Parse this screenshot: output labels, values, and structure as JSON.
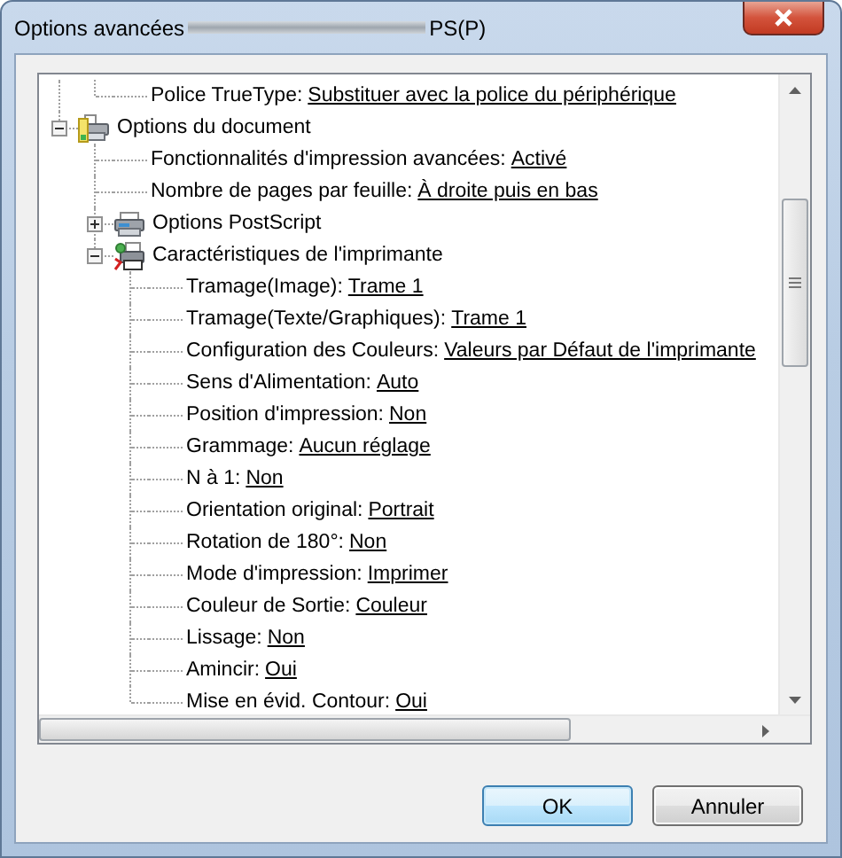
{
  "window": {
    "title": "Options avancées",
    "title_suffix": "PS(P)"
  },
  "tree": {
    "items": [
      {
        "children": [
          {
            "label": "Police TrueType:",
            "value": "Substituer avec la police du périphérique"
          }
        ]
      },
      {
        "label": "Options du document",
        "kind": "document",
        "expanded": true,
        "children": [
          {
            "label": "Fonctionnalités d'impression avancées:",
            "value": "Activé"
          },
          {
            "label": "Nombre de pages par feuille:",
            "value": "À droite puis en bas"
          },
          {
            "label": "Options PostScript",
            "kind": "postscript",
            "expanded": false
          },
          {
            "label": "Caractéristiques de l'imprimante",
            "kind": "device",
            "expanded": true,
            "children": [
              {
                "label": "Tramage(Image):",
                "value": "Trame 1"
              },
              {
                "label": "Tramage(Texte/Graphiques):",
                "value": "Trame 1"
              },
              {
                "label": "Configuration des Couleurs:",
                "value": "Valeurs par Défaut de l'imprimante"
              },
              {
                "label": "Sens d'Alimentation:",
                "value": "Auto"
              },
              {
                "label": "Position d'impression:",
                "value": "Non"
              },
              {
                "label": "Grammage:",
                "value": "Aucun réglage"
              },
              {
                "label": "N à 1:",
                "value": "Non"
              },
              {
                "label": "Orientation original:",
                "value": "Portrait"
              },
              {
                "label": "Rotation de 180°:",
                "value": "Non"
              },
              {
                "label": "Mode d'impression:",
                "value": "Imprimer"
              },
              {
                "label": "Couleur de Sortie:",
                "value": "Couleur"
              },
              {
                "label": "Lissage:",
                "value": "Non"
              },
              {
                "label": "Amincir:",
                "value": "Oui"
              },
              {
                "label": "Mise en évid. Contour:",
                "value": "Oui"
              }
            ]
          }
        ]
      }
    ]
  },
  "buttons": [
    {
      "label": "OK",
      "default": true
    },
    {
      "label": "Annuler",
      "default": false
    }
  ]
}
